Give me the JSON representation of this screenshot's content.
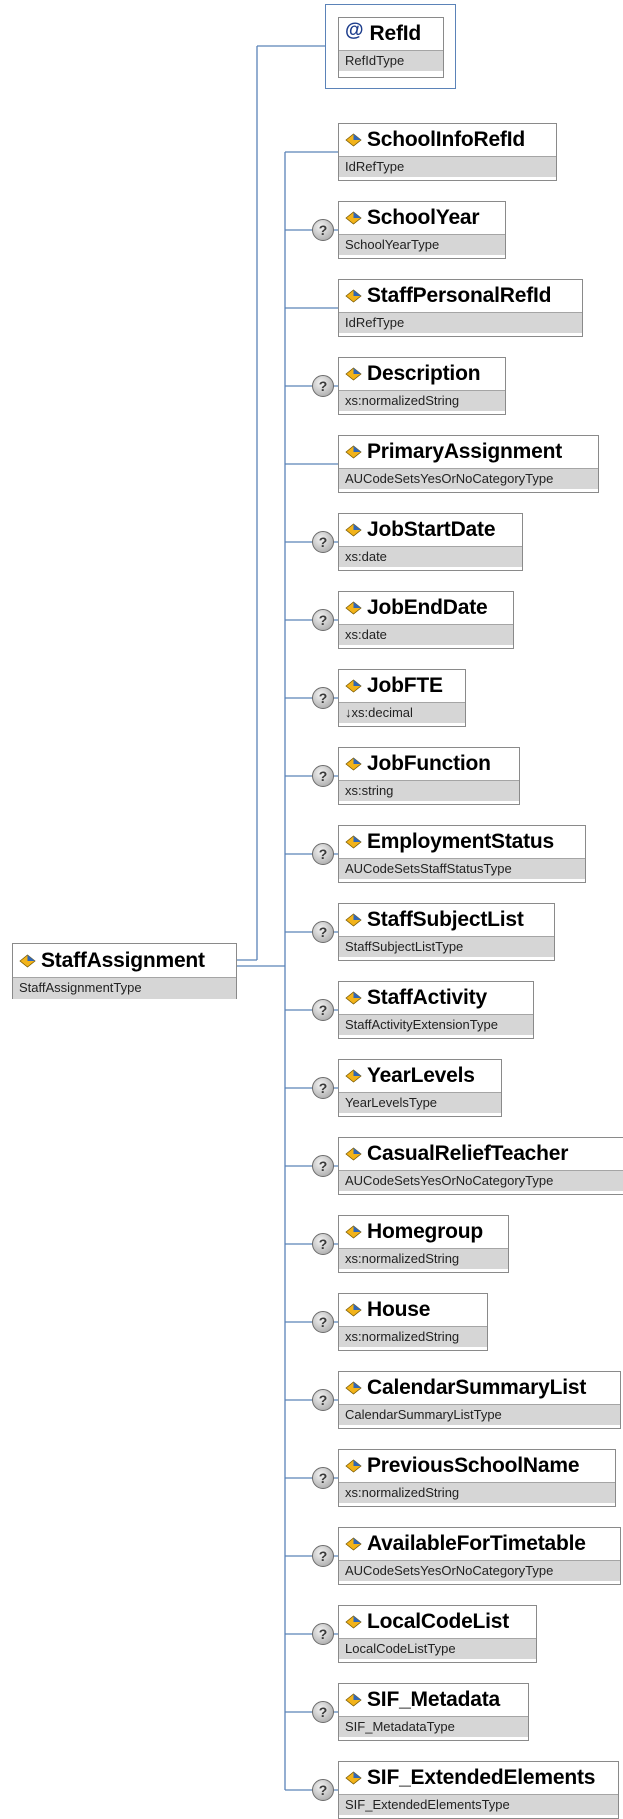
{
  "root": {
    "name": "StaffAssignment",
    "type": "StaffAssignmentType",
    "icon": "element-icon"
  },
  "attribute": {
    "name": "RefId",
    "type": "RefIdType",
    "icon_glyph": "@",
    "icon": "attribute-icon"
  },
  "optional_icon": {
    "glyph": "?",
    "icon": "optional-icon"
  },
  "colors": {
    "connector": "#5b83b8",
    "type_bar": "#d6d6d6",
    "border": "#8a8a8a"
  },
  "children": [
    {
      "name": "SchoolInfoRefId",
      "type": "IdRefType",
      "optional": false
    },
    {
      "name": "SchoolYear",
      "type": "SchoolYearType",
      "optional": true
    },
    {
      "name": "StaffPersonalRefId",
      "type": "IdRefType",
      "optional": false
    },
    {
      "name": "Description",
      "type": "xs:normalizedString",
      "optional": true
    },
    {
      "name": "PrimaryAssignment",
      "type": "AUCodeSetsYesOrNoCategoryType",
      "optional": false
    },
    {
      "name": "JobStartDate",
      "type": "xs:date",
      "optional": true
    },
    {
      "name": "JobEndDate",
      "type": "xs:date",
      "optional": true
    },
    {
      "name": "JobFTE",
      "type": "↓xs:decimal",
      "optional": true
    },
    {
      "name": "JobFunction",
      "type": "xs:string",
      "optional": true
    },
    {
      "name": "EmploymentStatus",
      "type": "AUCodeSetsStaffStatusType",
      "optional": true
    },
    {
      "name": "StaffSubjectList",
      "type": "StaffSubjectListType",
      "optional": true
    },
    {
      "name": "StaffActivity",
      "type": "StaffActivityExtensionType",
      "optional": true
    },
    {
      "name": "YearLevels",
      "type": "YearLevelsType",
      "optional": true
    },
    {
      "name": "CasualReliefTeacher",
      "type": "AUCodeSetsYesOrNoCategoryType",
      "optional": true
    },
    {
      "name": "Homegroup",
      "type": "xs:normalizedString",
      "optional": true
    },
    {
      "name": "House",
      "type": "xs:normalizedString",
      "optional": true
    },
    {
      "name": "CalendarSummaryList",
      "type": "CalendarSummaryListType",
      "optional": true
    },
    {
      "name": "PreviousSchoolName",
      "type": "xs:normalizedString",
      "optional": true
    },
    {
      "name": "AvailableForTimetable",
      "type": "AUCodeSetsYesOrNoCategoryType",
      "optional": true
    },
    {
      "name": "LocalCodeList",
      "type": "LocalCodeListType",
      "optional": true
    },
    {
      "name": "SIF_Metadata",
      "type": "SIF_MetadataType",
      "optional": true
    },
    {
      "name": "SIF_ExtendedElements",
      "type": "SIF_ExtendedElementsType",
      "optional": true
    }
  ]
}
